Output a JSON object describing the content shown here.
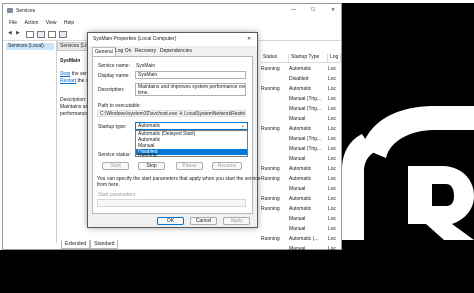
{
  "window": {
    "title": "Services",
    "minimize": "—",
    "maximize": "☐",
    "close": "✕"
  },
  "menubar": [
    "File",
    "Action",
    "View",
    "Help"
  ],
  "tree": {
    "item": "Services (Local)"
  },
  "detail": {
    "tab": "Services (Local)",
    "service_name": "SysMain",
    "link_stop": "Stop",
    "stop_suffix": " the service",
    "link_restart": "Restart",
    "restart_suffix": " the service",
    "desc_label": "Description:",
    "desc_line1": "Maintains and",
    "desc_line2": "performance"
  },
  "columns": {
    "status": "Status",
    "startup": "Startup Type",
    "log": "Log"
  },
  "rows": [
    {
      "status": "Running",
      "startup": "Automatic",
      "log": "Loc"
    },
    {
      "status": "",
      "startup": "Disabled",
      "log": "Loc"
    },
    {
      "status": "Running",
      "startup": "Automatic",
      "log": "Loc"
    },
    {
      "status": "",
      "startup": "Manual (Trig...",
      "log": "Loc"
    },
    {
      "status": "",
      "startup": "Manual (Trig...",
      "log": "Loc"
    },
    {
      "status": "",
      "startup": "Manual",
      "log": "Loc"
    },
    {
      "status": "Running",
      "startup": "Automatic",
      "log": "Loc"
    },
    {
      "status": "",
      "startup": "Manual (Trig...",
      "log": "Loc"
    },
    {
      "status": "",
      "startup": "Manual (Trig...",
      "log": "Loc"
    },
    {
      "status": "",
      "startup": "Manual",
      "log": "Loc"
    },
    {
      "status": "Running",
      "startup": "Automatic",
      "log": "Loc"
    },
    {
      "status": "Running",
      "startup": "Automatic",
      "log": "Loc"
    },
    {
      "status": "",
      "startup": "Manual",
      "log": "Loc"
    },
    {
      "status": "Running",
      "startup": "Automatic",
      "log": "Loc"
    },
    {
      "status": "Running",
      "startup": "Automatic",
      "log": "Loc"
    },
    {
      "status": "",
      "startup": "Manual",
      "log": "Loc"
    },
    {
      "status": "",
      "startup": "Manual",
      "log": "Loc"
    },
    {
      "status": "Running",
      "startup": "Automatic (...",
      "log": "Loc"
    },
    {
      "status": "",
      "startup": "Manual",
      "log": "Loc"
    }
  ],
  "bottom_tabs": [
    "Extended",
    "Standard"
  ],
  "dialog": {
    "title": "SysMain Properties (Local Computer)",
    "tabs": [
      "General",
      "Log On",
      "Recovery",
      "Dependencies"
    ],
    "service_name_label": "Service name:",
    "service_name_value": "SysMain",
    "display_name_label": "Display name:",
    "display_name_value": "SysMain",
    "description_label": "Description:",
    "description_value_line1": "Maintains and improves system performance over",
    "description_value_line2": "time.",
    "path_label": "Path to executable:",
    "path_value": "C:\\Windows\\system32\\svchost.exe -k LocalSystemNetworkRestricted -p",
    "startup_label": "Startup type:",
    "startup_value": "Automatic",
    "startup_options": [
      "Automatic (Delayed Start)",
      "Automatic",
      "Manual",
      "Disabled"
    ],
    "startup_selected_index": 3,
    "status_label": "Service status:",
    "status_value": "Running",
    "start_btn": "Start",
    "stop_btn": "Stop",
    "pause_btn": "Pause",
    "resume_btn": "Resume",
    "help_line1": "You can specify the start parameters that apply when you start the service",
    "help_line2": "from here.",
    "params_label": "Start parameters:",
    "ok": "OK",
    "cancel": "Cancel",
    "apply": "Apply"
  },
  "colors": {
    "accent": "#0078d7",
    "background_logo": "#000000"
  }
}
